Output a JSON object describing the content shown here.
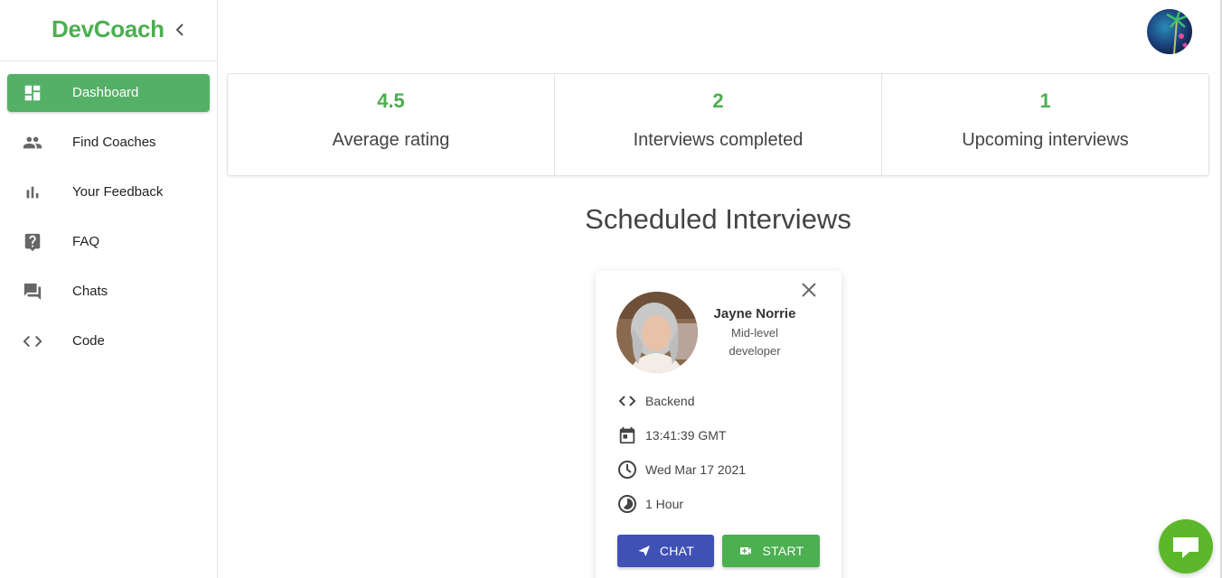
{
  "brand": {
    "name": "DevCoach"
  },
  "sidebar": {
    "items": [
      {
        "label": "Dashboard",
        "icon": "dashboard-icon",
        "active": true
      },
      {
        "label": "Find Coaches",
        "icon": "people-icon",
        "active": false
      },
      {
        "label": "Your Feedback",
        "icon": "bar-chart-icon",
        "active": false
      },
      {
        "label": "FAQ",
        "icon": "help-icon",
        "active": false
      },
      {
        "label": "Chats",
        "icon": "forum-icon",
        "active": false
      },
      {
        "label": "Code",
        "icon": "code-icon",
        "active": false
      }
    ]
  },
  "stats": [
    {
      "value": "4.5",
      "label": "Average rating"
    },
    {
      "value": "2",
      "label": "Interviews completed"
    },
    {
      "value": "1",
      "label": "Upcoming interviews"
    }
  ],
  "section_title": "Scheduled Interviews",
  "interview": {
    "coach_name": "Jayne Norrie",
    "coach_level_line1": "Mid-level",
    "coach_level_line2": "developer",
    "topic": "Backend",
    "time": "13:41:39 GMT",
    "date": "Wed Mar 17 2021",
    "duration": "1 Hour",
    "chat_label": "CHAT",
    "start_label": "START"
  },
  "colors": {
    "accent": "#4caf50",
    "primary": "#3f51b5",
    "fab": "#5cb82a"
  }
}
